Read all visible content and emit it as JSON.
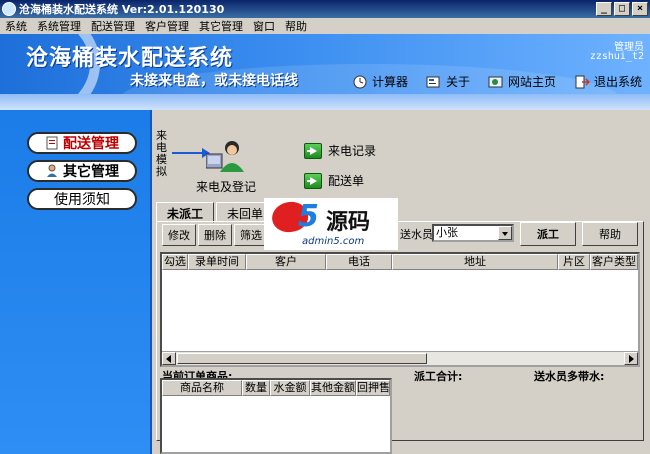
{
  "window": {
    "title": "沧海桶装水配送系统 Ver:2.01.120130",
    "min_glyph": "_",
    "max_glyph": "□",
    "close_glyph": "×"
  },
  "menu": [
    "系统",
    "系统管理",
    "配送管理",
    "客户管理",
    "其它管理",
    "窗口",
    "帮助"
  ],
  "banner": {
    "app_title": "沧海桶装水配送系统",
    "notice": "未接来电盒，或未接电话线",
    "user_role": "管理员",
    "user_id": "zzshui_t2"
  },
  "toolbar": {
    "calculator": "计算器",
    "about": "关于",
    "website": "网站主页",
    "exit": "退出系统"
  },
  "leftnav": {
    "delivery": "配送管理",
    "other": "其它管理",
    "guide": "使用须知"
  },
  "main": {
    "simulate_label": "来电模拟",
    "call_register": "来电及登记",
    "call_records": "来电记录",
    "delivery_order": "配送单",
    "tabs": [
      "未派工",
      "未回单"
    ],
    "buttons": {
      "edit": "修改",
      "delete": "删除",
      "filter": "筛选",
      "dispatch": "派工",
      "help": "帮助"
    },
    "courier_label": "送水员",
    "courier_value": "小张",
    "grid_columns": [
      "勾选",
      "录单时间",
      "客户",
      "电话",
      "地址",
      "片区",
      "客户类型"
    ],
    "current_goods_label": "当前订单商品:",
    "dispatch_total_label": "派工合计:",
    "courier_carry_label": "送水员多带水:",
    "goods_columns": [
      "商品名称",
      "数量",
      "水金额",
      "其他金额",
      "回押售"
    ]
  },
  "watermark": {
    "brand": "源码",
    "site": "admin5.com"
  }
}
